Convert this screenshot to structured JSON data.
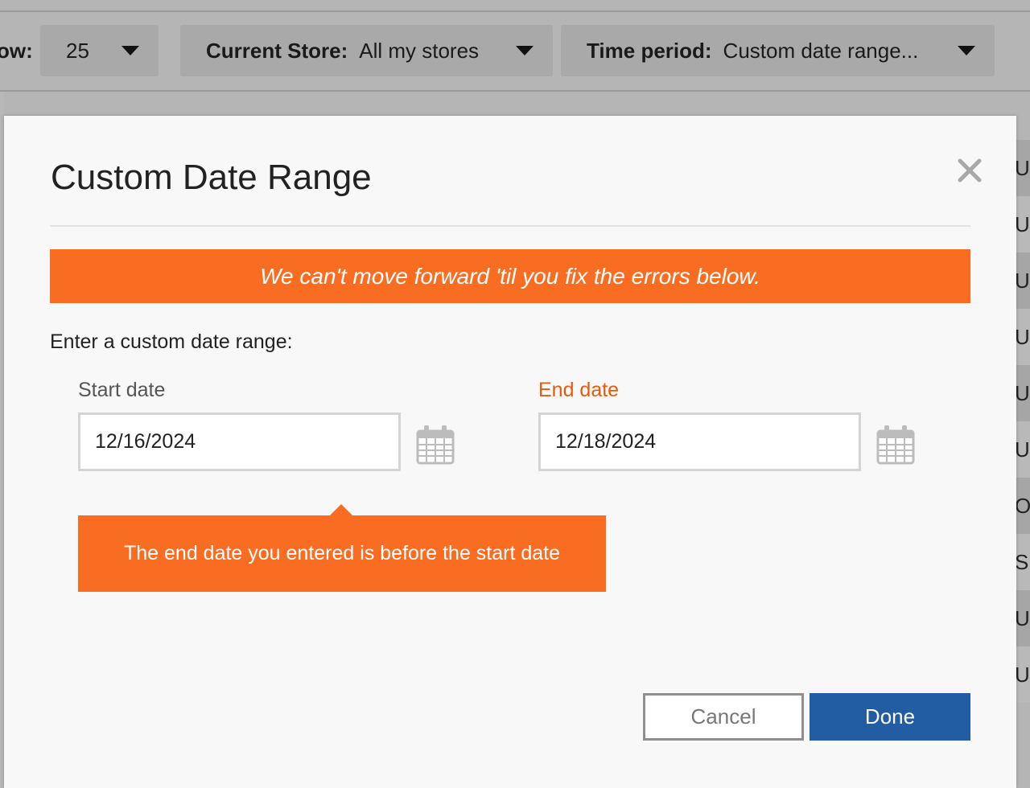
{
  "background": {
    "rows_label": "ow:",
    "rows_value": "25",
    "store_label": "Current Store:",
    "store_value": "All my stores",
    "time_label": "Time period:",
    "time_value": "Custom date range...",
    "right_column_fragments": [
      "U",
      "US",
      "US",
      "U",
      "US",
      "U",
      "OU",
      "SU",
      "US",
      "US"
    ]
  },
  "modal": {
    "title": "Custom Date Range",
    "close_icon": "close-icon",
    "error_banner": "We can't move forward 'til you fix the errors below.",
    "prompt": "Enter a custom date range:",
    "start_label": "Start date",
    "start_value": "12/16/2024",
    "end_label": "End date",
    "end_value": "12/18/2024",
    "calendar_icon": "calendar-icon",
    "tooltip": "The end date you entered is before the start date",
    "cancel_label": "Cancel",
    "done_label": "Done"
  },
  "colors": {
    "error_orange": "#f96d22",
    "error_text_orange": "#e75a0c",
    "primary_blue": "#225ca2"
  }
}
